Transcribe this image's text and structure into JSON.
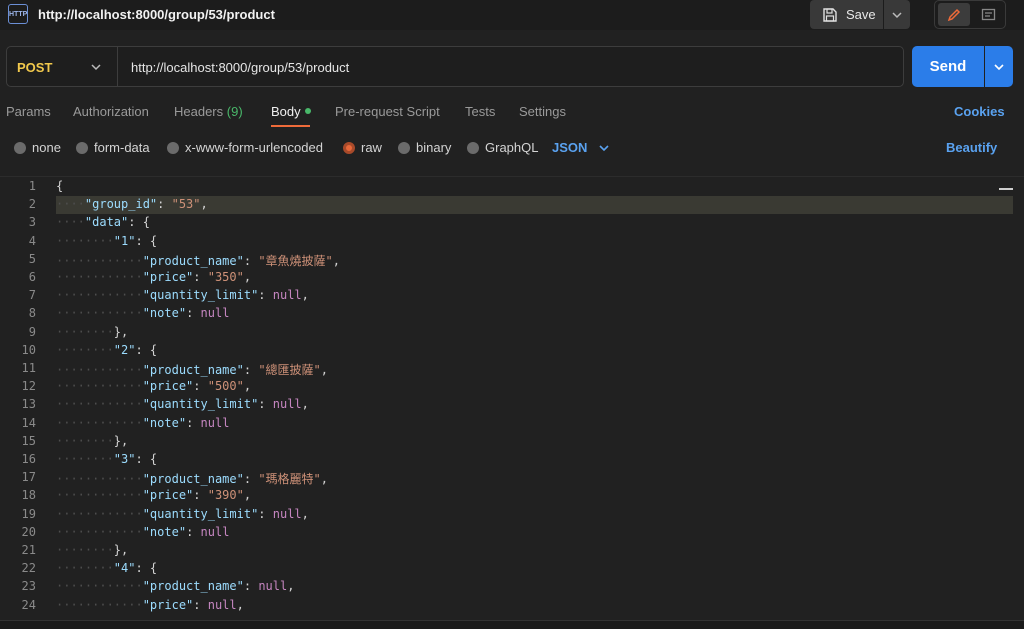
{
  "request": {
    "icon_label": "HTTP",
    "title": "http://localhost:8000/group/53/product",
    "method": "POST",
    "url": "http://localhost:8000/group/53/product"
  },
  "toolbar": {
    "save_label": "Save",
    "send_label": "Send"
  },
  "tabs": [
    {
      "label": "Params"
    },
    {
      "label": "Authorization"
    },
    {
      "label": "Headers",
      "count": "(9)"
    },
    {
      "label": "Body"
    },
    {
      "label": "Pre-request Script"
    },
    {
      "label": "Tests"
    },
    {
      "label": "Settings"
    }
  ],
  "cookies_label": "Cookies",
  "body_options": [
    {
      "label": "none"
    },
    {
      "label": "form-data"
    },
    {
      "label": "x-www-form-urlencoded"
    },
    {
      "label": "raw",
      "selected": true
    },
    {
      "label": "binary"
    },
    {
      "label": "GraphQL"
    }
  ],
  "format": "JSON",
  "beautify_label": "Beautify",
  "editor": {
    "lines": [
      {
        "n": "1",
        "indent": 0,
        "parts": [
          {
            "t": "{",
            "c": "p"
          }
        ]
      },
      {
        "n": "2",
        "indent": 1,
        "parts": [
          {
            "t": "\"group_id\"",
            "c": "k"
          },
          {
            "t": ": ",
            "c": "p"
          },
          {
            "t": "\"53\"",
            "c": "s"
          },
          {
            "t": ",",
            "c": "p"
          }
        ]
      },
      {
        "n": "3",
        "indent": 1,
        "parts": [
          {
            "t": "\"data\"",
            "c": "k"
          },
          {
            "t": ": {",
            "c": "p"
          }
        ]
      },
      {
        "n": "4",
        "indent": 2,
        "parts": [
          {
            "t": "\"1\"",
            "c": "k"
          },
          {
            "t": ": {",
            "c": "p"
          }
        ]
      },
      {
        "n": "5",
        "indent": 3,
        "parts": [
          {
            "t": "\"product_name\"",
            "c": "k"
          },
          {
            "t": ": ",
            "c": "p"
          },
          {
            "t": "\"章魚燒披薩\"",
            "c": "s"
          },
          {
            "t": ",",
            "c": "p"
          }
        ]
      },
      {
        "n": "6",
        "indent": 3,
        "parts": [
          {
            "t": "\"price\"",
            "c": "k"
          },
          {
            "t": ": ",
            "c": "p"
          },
          {
            "t": "\"350\"",
            "c": "s"
          },
          {
            "t": ",",
            "c": "p"
          }
        ]
      },
      {
        "n": "7",
        "indent": 3,
        "parts": [
          {
            "t": "\"quantity_limit\"",
            "c": "k"
          },
          {
            "t": ": ",
            "c": "p"
          },
          {
            "t": "null",
            "c": "n"
          },
          {
            "t": ",",
            "c": "p"
          }
        ]
      },
      {
        "n": "8",
        "indent": 3,
        "parts": [
          {
            "t": "\"note\"",
            "c": "k"
          },
          {
            "t": ": ",
            "c": "p"
          },
          {
            "t": "null",
            "c": "n"
          }
        ]
      },
      {
        "n": "9",
        "indent": 2,
        "parts": [
          {
            "t": "},",
            "c": "p"
          }
        ]
      },
      {
        "n": "10",
        "indent": 2,
        "parts": [
          {
            "t": "\"2\"",
            "c": "k"
          },
          {
            "t": ": {",
            "c": "p"
          }
        ]
      },
      {
        "n": "11",
        "indent": 3,
        "parts": [
          {
            "t": "\"product_name\"",
            "c": "k"
          },
          {
            "t": ": ",
            "c": "p"
          },
          {
            "t": "\"總匯披薩\"",
            "c": "s"
          },
          {
            "t": ",",
            "c": "p"
          }
        ]
      },
      {
        "n": "12",
        "indent": 3,
        "parts": [
          {
            "t": "\"price\"",
            "c": "k"
          },
          {
            "t": ": ",
            "c": "p"
          },
          {
            "t": "\"500\"",
            "c": "s"
          },
          {
            "t": ",",
            "c": "p"
          }
        ]
      },
      {
        "n": "13",
        "indent": 3,
        "parts": [
          {
            "t": "\"quantity_limit\"",
            "c": "k"
          },
          {
            "t": ": ",
            "c": "p"
          },
          {
            "t": "null",
            "c": "n"
          },
          {
            "t": ",",
            "c": "p"
          }
        ]
      },
      {
        "n": "14",
        "indent": 3,
        "parts": [
          {
            "t": "\"note\"",
            "c": "k"
          },
          {
            "t": ": ",
            "c": "p"
          },
          {
            "t": "null",
            "c": "n"
          }
        ]
      },
      {
        "n": "15",
        "indent": 2,
        "parts": [
          {
            "t": "},",
            "c": "p"
          }
        ]
      },
      {
        "n": "16",
        "indent": 2,
        "parts": [
          {
            "t": "\"3\"",
            "c": "k"
          },
          {
            "t": ": {",
            "c": "p"
          }
        ]
      },
      {
        "n": "17",
        "indent": 3,
        "parts": [
          {
            "t": "\"product_name\"",
            "c": "k"
          },
          {
            "t": ": ",
            "c": "p"
          },
          {
            "t": "\"瑪格麗特\"",
            "c": "s"
          },
          {
            "t": ",",
            "c": "p"
          }
        ]
      },
      {
        "n": "18",
        "indent": 3,
        "parts": [
          {
            "t": "\"price\"",
            "c": "k"
          },
          {
            "t": ": ",
            "c": "p"
          },
          {
            "t": "\"390\"",
            "c": "s"
          },
          {
            "t": ",",
            "c": "p"
          }
        ]
      },
      {
        "n": "19",
        "indent": 3,
        "parts": [
          {
            "t": "\"quantity_limit\"",
            "c": "k"
          },
          {
            "t": ": ",
            "c": "p"
          },
          {
            "t": "null",
            "c": "n"
          },
          {
            "t": ",",
            "c": "p"
          }
        ]
      },
      {
        "n": "20",
        "indent": 3,
        "parts": [
          {
            "t": "\"note\"",
            "c": "k"
          },
          {
            "t": ": ",
            "c": "p"
          },
          {
            "t": "null",
            "c": "n"
          }
        ]
      },
      {
        "n": "21",
        "indent": 2,
        "parts": [
          {
            "t": "},",
            "c": "p"
          }
        ]
      },
      {
        "n": "22",
        "indent": 2,
        "parts": [
          {
            "t": "\"4\"",
            "c": "k"
          },
          {
            "t": ": {",
            "c": "p"
          }
        ]
      },
      {
        "n": "23",
        "indent": 3,
        "parts": [
          {
            "t": "\"product_name\"",
            "c": "k"
          },
          {
            "t": ": ",
            "c": "p"
          },
          {
            "t": "null",
            "c": "n"
          },
          {
            "t": ",",
            "c": "p"
          }
        ]
      },
      {
        "n": "24",
        "indent": 3,
        "parts": [
          {
            "t": "\"price\"",
            "c": "k"
          },
          {
            "t": ": ",
            "c": "p"
          },
          {
            "t": "null",
            "c": "n"
          },
          {
            "t": ",",
            "c": "p"
          }
        ]
      }
    ]
  }
}
